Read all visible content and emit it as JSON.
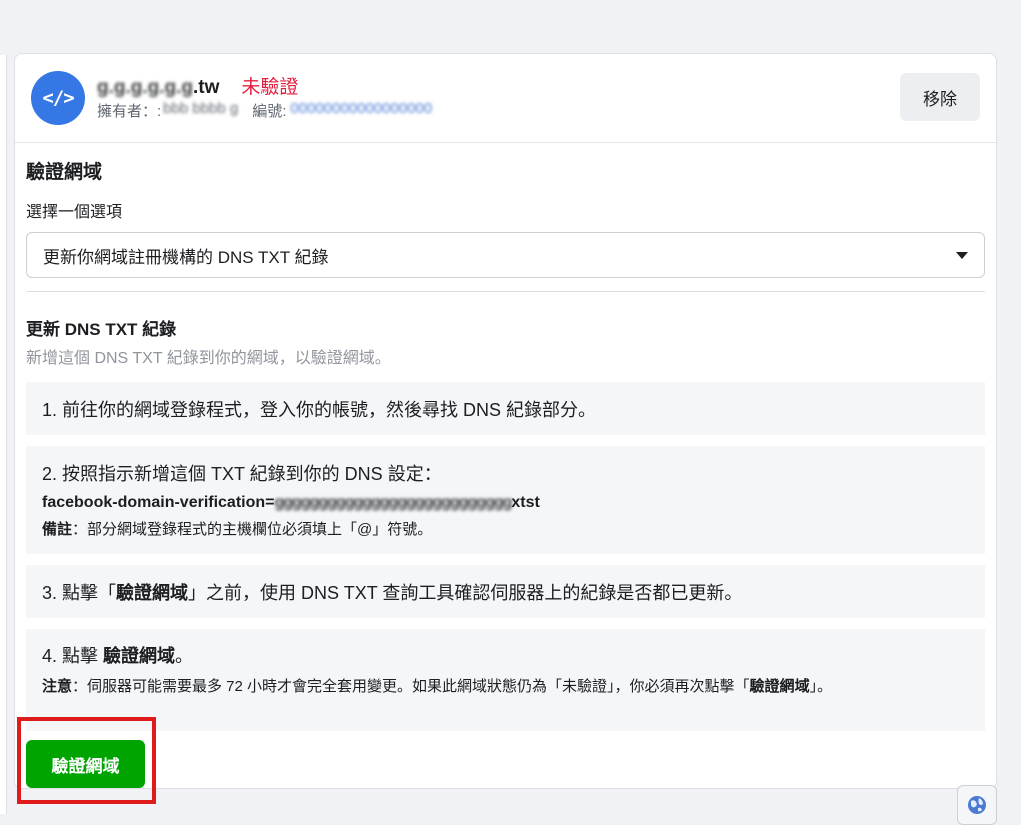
{
  "domain": {
    "icon": "code-icon",
    "name_obscured": "g.g.g.g.g.g",
    "name_suffix": ".tw",
    "status": "未驗證",
    "owner_label": "擁有者：:",
    "owner_value": "bbb bbbb g",
    "id_label": "編號:",
    "id_value": "00000000000000000",
    "remove_label": "移除"
  },
  "verify_section": {
    "title": "驗證網域",
    "select_label": "選擇一個選項",
    "selected_option": "更新你網域註冊機構的 DNS TXT 紀錄"
  },
  "dns_section": {
    "title": "更新 DNS TXT 紀錄",
    "subtitle": "新增這個 DNS TXT 紀錄到你的網域，以驗證網域。",
    "steps": [
      {
        "text": "1. 前往你的網域登錄程式，登入你的帳號，然後尋找 DNS 紀錄部分。"
      },
      {
        "text": "2. 按照指示新增這個 TXT 紀錄到你的 DNS 設定：",
        "record_prefix": "facebook-domain-verification=",
        "record_obscured": "ggggggggggggggggggggggggggg",
        "record_suffix": "xtst",
        "note_label": "備註",
        "note_text": "：部分網域登錄程式的主機欄位必須填上「@」符號。"
      },
      {
        "text_before": "3. 點擊「",
        "text_bold": "驗證網域",
        "text_after": "」之前，使用 DNS TXT 查詢工具確認伺服器上的紀錄是否都已更新。"
      },
      {
        "text_before": "4. 點擊 ",
        "text_bold": "驗證網域",
        "text_after": "。",
        "note_label": "注意",
        "note_text": "：伺服器可能需要最多 72 小時才會完全套用變更。如果此網域狀態仍為「未驗證」，你必須再次點擊「",
        "note_bold": "驗證網",
        "note_tail_bold": "域",
        "note_tail": "」。"
      }
    ]
  },
  "verify_button_label": "驗證網域",
  "colors": {
    "accent_blue": "#3578e5",
    "unverified_red": "#e41e3f",
    "verify_green": "#00a400",
    "highlight_red": "#e01b1b"
  }
}
